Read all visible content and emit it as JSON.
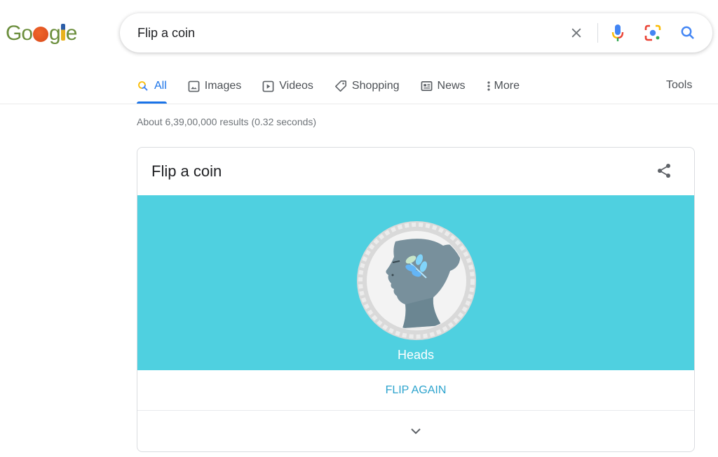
{
  "logo": {
    "text_start": "Go",
    "text_mid": "g",
    "text_end": "e",
    "alt": "Google"
  },
  "search": {
    "query": "Flip a coin",
    "placeholder": ""
  },
  "tabs": [
    {
      "label": "All",
      "icon": "search-icon",
      "active": true
    },
    {
      "label": "Images",
      "icon": "image-icon"
    },
    {
      "label": "Videos",
      "icon": "play-icon"
    },
    {
      "label": "Shopping",
      "icon": "tag-icon"
    },
    {
      "label": "News",
      "icon": "newspaper-icon"
    },
    {
      "label": "More",
      "icon": "more-vert-icon"
    }
  ],
  "tools_label": "Tools",
  "result_stats": "About 6,39,00,000 results (0.32 seconds)",
  "coin_card": {
    "title": "Flip a coin",
    "result": "Heads",
    "flip_again_label": "FLIP AGAIN",
    "colors": {
      "background": "#4fd0e0",
      "button_text": "#2ba3cd"
    }
  },
  "colors": {
    "accent": "#1a73e8",
    "text_secondary": "#70757a"
  }
}
